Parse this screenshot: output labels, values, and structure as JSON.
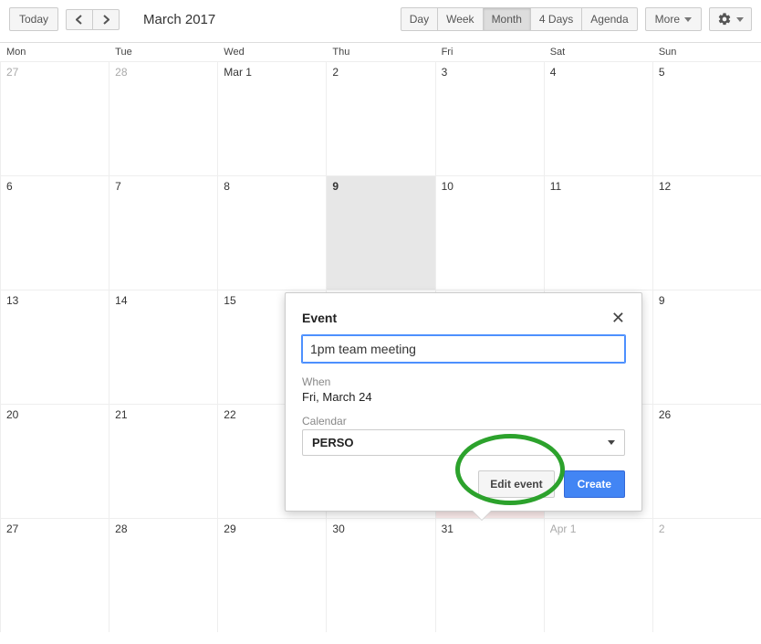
{
  "toolbar": {
    "today": "Today",
    "month_label": "March 2017",
    "views": {
      "day": "Day",
      "week": "Week",
      "month": "Month",
      "four_days": "4 Days",
      "agenda": "Agenda"
    },
    "more": "More"
  },
  "dow": [
    "Mon",
    "Tue",
    "Wed",
    "Thu",
    "Fri",
    "Sat",
    "Sun"
  ],
  "weeks": [
    [
      {
        "n": "27",
        "o": true
      },
      {
        "n": "28",
        "o": true
      },
      {
        "n": "Mar 1"
      },
      {
        "n": "2"
      },
      {
        "n": "3"
      },
      {
        "n": "4"
      },
      {
        "n": "5"
      }
    ],
    [
      {
        "n": "6"
      },
      {
        "n": "7"
      },
      {
        "n": "8"
      },
      {
        "n": "9",
        "hl": true
      },
      {
        "n": "10"
      },
      {
        "n": "11"
      },
      {
        "n": "12"
      }
    ],
    [
      {
        "n": "13"
      },
      {
        "n": "14"
      },
      {
        "n": "15"
      },
      {
        "n": ""
      },
      {
        "n": ""
      },
      {
        "n": ""
      },
      {
        "n": "9"
      }
    ],
    [
      {
        "n": "20"
      },
      {
        "n": "21"
      },
      {
        "n": "22"
      },
      {
        "n": ""
      },
      {
        "n": "",
        "ev": true
      },
      {
        "n": ""
      },
      {
        "n": "26"
      }
    ],
    [
      {
        "n": "27"
      },
      {
        "n": "28"
      },
      {
        "n": "29"
      },
      {
        "n": "30"
      },
      {
        "n": "31"
      },
      {
        "n": "Apr 1",
        "o": true
      },
      {
        "n": "2",
        "o": true
      }
    ]
  ],
  "popover": {
    "title": "Event",
    "input_value": "1pm team meeting",
    "when_label": "When",
    "when_value": "Fri, March 24",
    "calendar_label": "Calendar",
    "calendar_value": "PERSO",
    "edit": "Edit event",
    "create": "Create"
  }
}
